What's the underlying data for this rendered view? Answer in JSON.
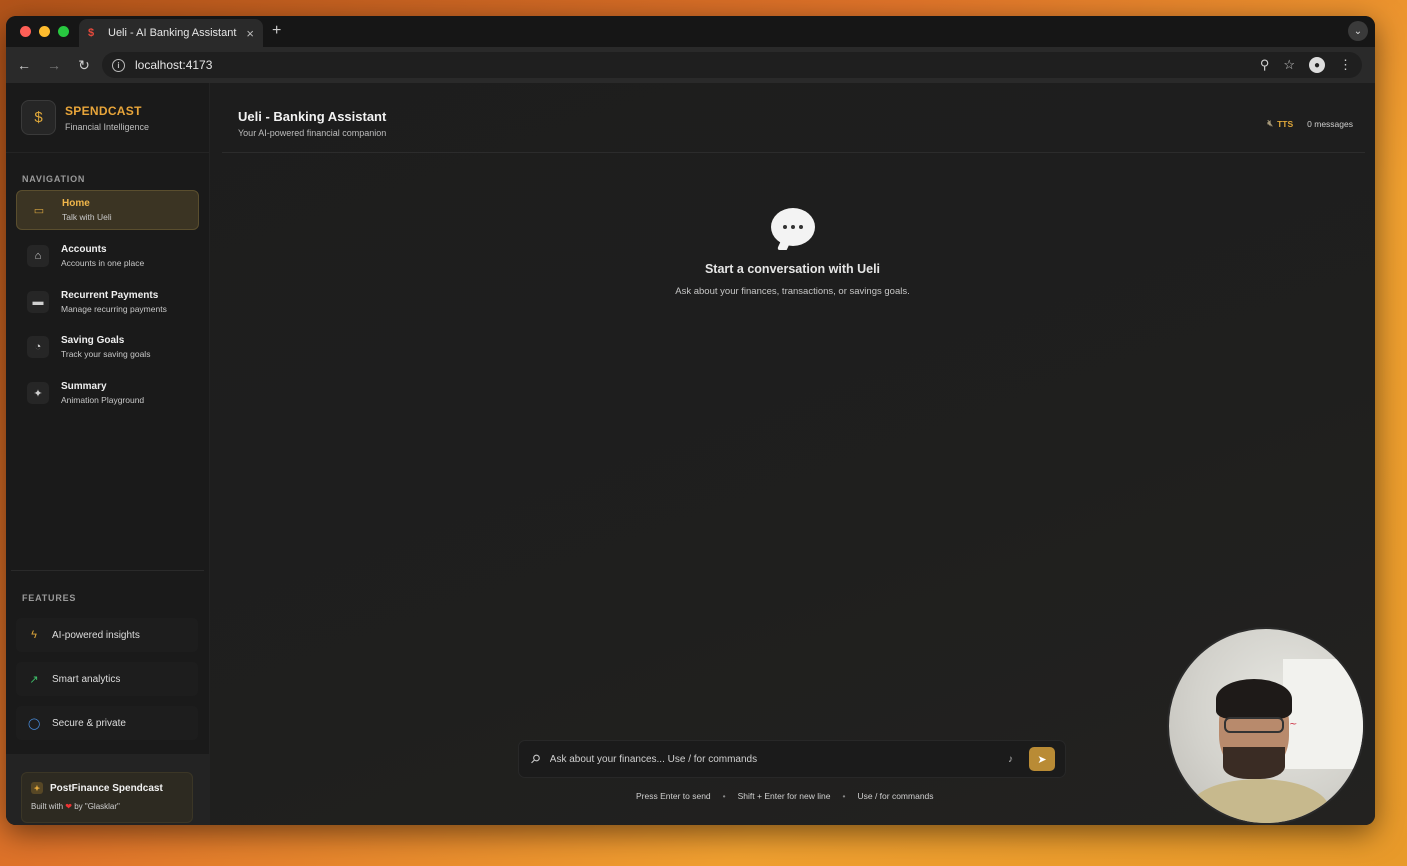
{
  "browser": {
    "tab_title": "Ueli - AI Banking Assistant",
    "url": "localhost:4173"
  },
  "sidebar": {
    "brand_name": "SPENDCAST",
    "brand_sub": "Financial Intelligence",
    "nav_label": "NAVIGATION",
    "items": [
      {
        "title": "Home",
        "subtitle": "Talk with Ueli",
        "icon": "chat-icon",
        "active": true
      },
      {
        "title": "Accounts",
        "subtitle": "Accounts in one place",
        "icon": "home-icon"
      },
      {
        "title": "Recurrent Payments",
        "subtitle": "Manage recurring payments",
        "icon": "credit-card-icon"
      },
      {
        "title": "Saving Goals",
        "subtitle": "Track your saving goals",
        "icon": "piggy-bank-icon"
      },
      {
        "title": "Summary",
        "subtitle": "Animation Playground",
        "icon": "sparkles-icon"
      }
    ],
    "features_label": "FEATURES",
    "features": [
      {
        "label": "AI-powered insights",
        "icon": "bolt-icon",
        "color": "#e0a83a"
      },
      {
        "label": "Smart analytics",
        "icon": "trend-up-icon",
        "color": "#3fbf6a"
      },
      {
        "label": "Secure & private",
        "icon": "shield-icon",
        "color": "#4a90e2"
      }
    ],
    "promo_title": "PostFinance Spendcast",
    "promo_sub_before": "Built with",
    "promo_sub_after": "by \"Glasklar\""
  },
  "main": {
    "title": "Ueli - Banking Assistant",
    "subtitle": "Your AI-powered financial companion",
    "tts_label": "TTS",
    "message_count": "0 messages",
    "empty_title": "Start a conversation with Ueli",
    "empty_sub": "Ask about your finances, transactions, or savings goals.",
    "input_placeholder": "Ask about your finances... Use / for commands",
    "hints": [
      "Press Enter to send",
      "Shift + Enter for new line",
      "Use / for commands"
    ]
  },
  "colors": {
    "accent": "#e8a53a",
    "send_button": "#b98b35"
  }
}
